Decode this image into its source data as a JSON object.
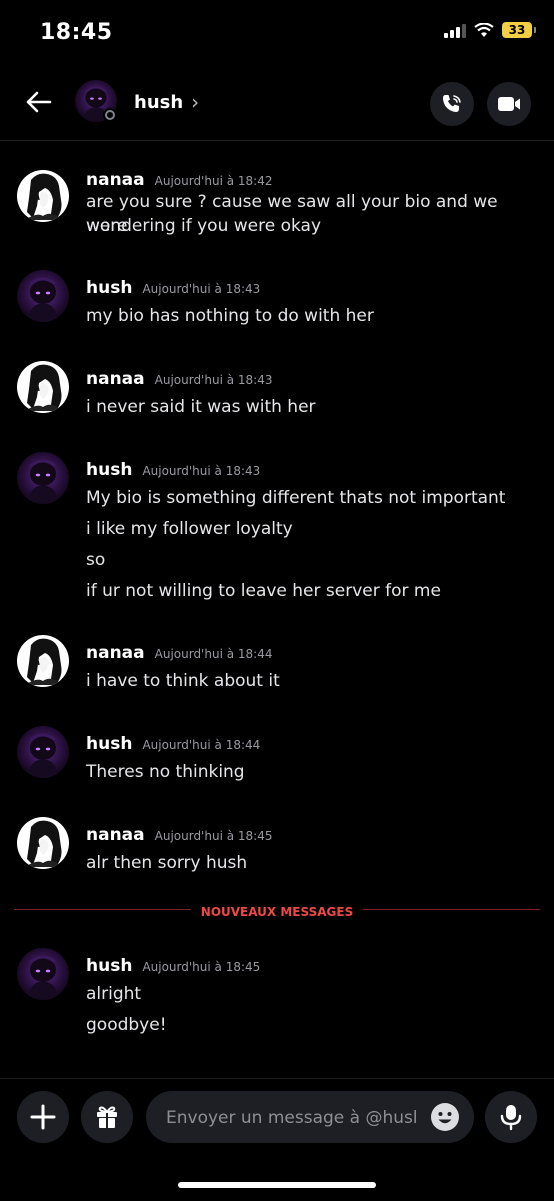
{
  "status_bar": {
    "time": "18:45",
    "battery": "33"
  },
  "header": {
    "contact_name": "hush",
    "chevron": "›"
  },
  "messages": [
    {
      "author": "nanaa",
      "time": "Aujourd'hui à 18:42",
      "lines": [
        "are you sure ? cause we saw all your bio and we were",
        "wondering if you were okay"
      ]
    },
    {
      "author": "hush",
      "time": "Aujourd'hui à 18:43",
      "lines": [
        "my bio has nothing to do with her"
      ]
    },
    {
      "author": "nanaa",
      "time": "Aujourd'hui à 18:43",
      "lines": [
        "i never said it was with her"
      ]
    },
    {
      "author": "hush",
      "time": "Aujourd'hui à 18:43",
      "lines": [
        "My bio is something different thats not important",
        "i like my follower loyalty",
        "so",
        "if ur not willing to leave her server for me"
      ]
    },
    {
      "author": "nanaa",
      "time": "Aujourd'hui à 18:44",
      "lines": [
        "i have to think about it"
      ]
    },
    {
      "author": "hush",
      "time": "Aujourd'hui à 18:44",
      "lines": [
        "Theres no thinking"
      ]
    },
    {
      "author": "nanaa",
      "time": "Aujourd'hui à 18:45",
      "lines": [
        "alr then sorry hush"
      ]
    },
    {
      "author": "hush",
      "time": "Aujourd'hui à 18:45",
      "lines": [
        "alright",
        "goodbye!"
      ]
    }
  ],
  "divider": {
    "label": "NOUVEAUX MESSAGES"
  },
  "composer": {
    "placeholder": "Envoyer un message à @hush"
  },
  "icons": {
    "back": "back-arrow-icon",
    "call": "phone-call-icon",
    "video": "video-camera-icon",
    "plus": "plus-icon",
    "gift": "gift-icon",
    "emoji": "emoji-icon",
    "mic": "microphone-icon"
  },
  "colors": {
    "background": "#000000",
    "divider": "#f04747",
    "button_bg": "#1e1f24",
    "battery": "#f2cf45"
  }
}
